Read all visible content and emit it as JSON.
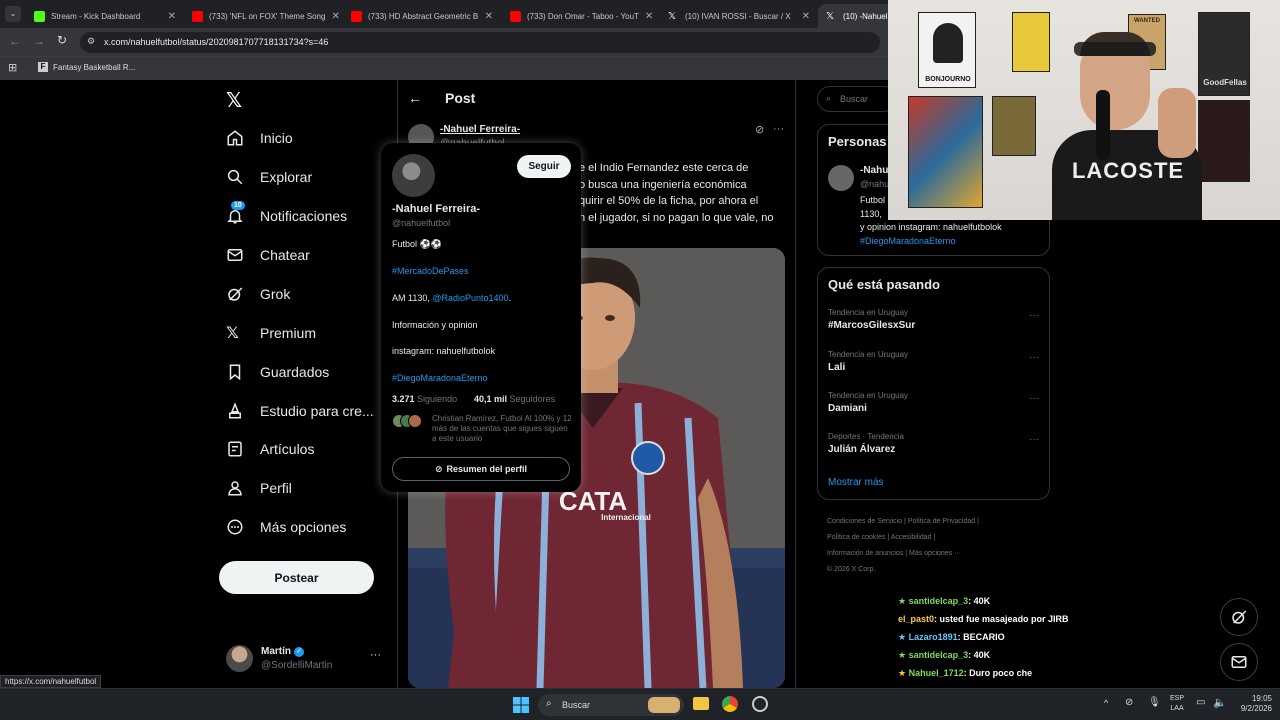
{
  "browser": {
    "tabs": [
      {
        "label": "Stream - Kick Dashboard",
        "color": "#53fc18"
      },
      {
        "label": "(733) 'NFL on FOX' Theme Song",
        "color": "#ff0000"
      },
      {
        "label": "(733) HD Abstract Geometric B",
        "color": "#ff0000"
      },
      {
        "label": "(733) Don Omar - Taboo - YouT",
        "color": "#ff0000"
      },
      {
        "label": "(10) IVAN ROSSI - Buscar / X",
        "color": "#ffffff"
      },
      {
        "label": "(10) -Nahuel",
        "color": "#ffffff"
      }
    ],
    "url": "x.com/nahuelfutbol/status/2020981707718131734?s=46",
    "bookmark": "Fantasy Basketball R...",
    "status_url": "https://x.com/nahuelfutbol"
  },
  "nav": {
    "items": [
      {
        "label": "Inicio",
        "icon": "home-icon"
      },
      {
        "label": "Explorar",
        "icon": "search-icon"
      },
      {
        "label": "Notificaciones",
        "icon": "bell-icon",
        "badge": "10"
      },
      {
        "label": "Chatear",
        "icon": "mail-icon"
      },
      {
        "label": "Grok",
        "icon": "grok-icon"
      },
      {
        "label": "Premium",
        "icon": "x-logo-icon"
      },
      {
        "label": "Guardados",
        "icon": "bookmark-icon"
      },
      {
        "label": "Estudio para cre...",
        "icon": "studio-icon"
      },
      {
        "label": "Artículos",
        "icon": "article-icon"
      },
      {
        "label": "Perfil",
        "icon": "person-icon"
      },
      {
        "label": "Más opciones",
        "icon": "more-circle-icon"
      }
    ],
    "post_button": "Postear",
    "account_name": "Martín",
    "account_handle": "@SordelliMartin"
  },
  "post": {
    "header": "Post",
    "author": "-Nahuel Ferreira-",
    "handle": "@nahuelfutbol",
    "text_lines": [
      "e el Indio Fernandez este cerca de",
      "o busca una ingeniería económica",
      "quirir el 50% de la ficha, por ahora el",
      "n el jugador, si no pagan lo que vale, no"
    ],
    "image_jersey_text": "CATA",
    "image_jersey_sub": "Internacional"
  },
  "hover_card": {
    "follow": "Seguir",
    "name": "-Nahuel Ferreira-",
    "handle": "@nahuelfutbol",
    "bio_line1": "Futbol ⚽⚽",
    "hashtag1": "#MercadoDePases",
    "am_prefix": "AM 1130, ",
    "am_link": "@RadioPunto1400",
    "info": "Información y opinion",
    "instagram": "instagram: nahuelfutbolok",
    "hashtag2": "#DiegoMaradonaEterno",
    "following_count": "3.271",
    "following_label": "Siguiendo",
    "followers_count": "40,1 mil",
    "followers_label": "Seguidores",
    "followed_by": "Christian Ramírez, Futbol Al 100% y 12 más de las cuentas que sigues siguen a este usuario",
    "summary_button": "Resumen del perfil"
  },
  "right": {
    "search_placeholder": "Buscar",
    "people_title": "Personas",
    "people_name": "-Nahu",
    "people_handle": "@nahu",
    "people_bio1": "Futbol",
    "people_bio2": "1130,",
    "people_bio3": "y opinion instagram: nahuelfutbolok",
    "people_bio4": "#DiegoMaradonaEterno",
    "trends_title": "Qué está pasando",
    "trends": [
      {
        "context": "Tendencia en Uruguay",
        "name": "#MarcosGilesxSur"
      },
      {
        "context": "Tendencia en Uruguay",
        "name": "Lali"
      },
      {
        "context": "Tendencia en Uruguay",
        "name": "Damiani"
      },
      {
        "context": "Deportes · Tendencia",
        "name": "Julián Álvarez"
      }
    ],
    "show_more": "Mostrar más",
    "footer_line1a": "Condiciones de Servicio",
    "footer_line1b": "Política de Privacidad",
    "footer_line2a": "Política de cookies",
    "footer_line2b": "Accesibilidad",
    "footer_line3a": "Información de anuncios",
    "footer_line3b": "Más opciones ···",
    "footer_copy": "© 2026 X Corp."
  },
  "chat": [
    {
      "user": "santidelcap_3",
      "msg": ": 40K",
      "color": "#7fdc5a"
    },
    {
      "user": "el_past0",
      "msg": ": usted fue masajeado por JIRB",
      "color": "#ffcc33"
    },
    {
      "user": "Lazaro1891",
      "msg": ": BECARIO",
      "color": "#63c7ff"
    },
    {
      "user": "santidelcap_3",
      "msg": ": 40K",
      "color": "#7fdc5a"
    },
    {
      "user": "Nahuel_1712",
      "msg": ": Duro poco che",
      "color": "#7fdc5a"
    }
  ],
  "webcam": {
    "poster_bonjourno": "BONJOURNO",
    "poster_wanted": "WANTED",
    "poster_goodfellas": "GoodFellas",
    "shirt_text": "LACOSTE"
  },
  "taskbar": {
    "search": "Buscar",
    "lang1": "ESP",
    "lang2": "LAA",
    "time": "19:05",
    "date": "9/2/2026"
  }
}
